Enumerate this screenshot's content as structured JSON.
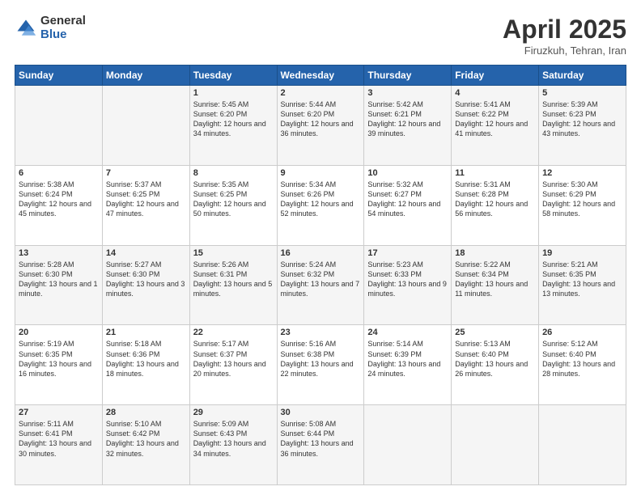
{
  "logo": {
    "general": "General",
    "blue": "Blue"
  },
  "title": "April 2025",
  "location": "Firuzkuh, Tehran, Iran",
  "weekdays": [
    "Sunday",
    "Monday",
    "Tuesday",
    "Wednesday",
    "Thursday",
    "Friday",
    "Saturday"
  ],
  "weeks": [
    [
      {
        "day": "",
        "info": ""
      },
      {
        "day": "",
        "info": ""
      },
      {
        "day": "1",
        "info": "Sunrise: 5:45 AM\nSunset: 6:20 PM\nDaylight: 12 hours and 34 minutes."
      },
      {
        "day": "2",
        "info": "Sunrise: 5:44 AM\nSunset: 6:20 PM\nDaylight: 12 hours and 36 minutes."
      },
      {
        "day": "3",
        "info": "Sunrise: 5:42 AM\nSunset: 6:21 PM\nDaylight: 12 hours and 39 minutes."
      },
      {
        "day": "4",
        "info": "Sunrise: 5:41 AM\nSunset: 6:22 PM\nDaylight: 12 hours and 41 minutes."
      },
      {
        "day": "5",
        "info": "Sunrise: 5:39 AM\nSunset: 6:23 PM\nDaylight: 12 hours and 43 minutes."
      }
    ],
    [
      {
        "day": "6",
        "info": "Sunrise: 5:38 AM\nSunset: 6:24 PM\nDaylight: 12 hours and 45 minutes."
      },
      {
        "day": "7",
        "info": "Sunrise: 5:37 AM\nSunset: 6:25 PM\nDaylight: 12 hours and 47 minutes."
      },
      {
        "day": "8",
        "info": "Sunrise: 5:35 AM\nSunset: 6:25 PM\nDaylight: 12 hours and 50 minutes."
      },
      {
        "day": "9",
        "info": "Sunrise: 5:34 AM\nSunset: 6:26 PM\nDaylight: 12 hours and 52 minutes."
      },
      {
        "day": "10",
        "info": "Sunrise: 5:32 AM\nSunset: 6:27 PM\nDaylight: 12 hours and 54 minutes."
      },
      {
        "day": "11",
        "info": "Sunrise: 5:31 AM\nSunset: 6:28 PM\nDaylight: 12 hours and 56 minutes."
      },
      {
        "day": "12",
        "info": "Sunrise: 5:30 AM\nSunset: 6:29 PM\nDaylight: 12 hours and 58 minutes."
      }
    ],
    [
      {
        "day": "13",
        "info": "Sunrise: 5:28 AM\nSunset: 6:30 PM\nDaylight: 13 hours and 1 minute."
      },
      {
        "day": "14",
        "info": "Sunrise: 5:27 AM\nSunset: 6:30 PM\nDaylight: 13 hours and 3 minutes."
      },
      {
        "day": "15",
        "info": "Sunrise: 5:26 AM\nSunset: 6:31 PM\nDaylight: 13 hours and 5 minutes."
      },
      {
        "day": "16",
        "info": "Sunrise: 5:24 AM\nSunset: 6:32 PM\nDaylight: 13 hours and 7 minutes."
      },
      {
        "day": "17",
        "info": "Sunrise: 5:23 AM\nSunset: 6:33 PM\nDaylight: 13 hours and 9 minutes."
      },
      {
        "day": "18",
        "info": "Sunrise: 5:22 AM\nSunset: 6:34 PM\nDaylight: 13 hours and 11 minutes."
      },
      {
        "day": "19",
        "info": "Sunrise: 5:21 AM\nSunset: 6:35 PM\nDaylight: 13 hours and 13 minutes."
      }
    ],
    [
      {
        "day": "20",
        "info": "Sunrise: 5:19 AM\nSunset: 6:35 PM\nDaylight: 13 hours and 16 minutes."
      },
      {
        "day": "21",
        "info": "Sunrise: 5:18 AM\nSunset: 6:36 PM\nDaylight: 13 hours and 18 minutes."
      },
      {
        "day": "22",
        "info": "Sunrise: 5:17 AM\nSunset: 6:37 PM\nDaylight: 13 hours and 20 minutes."
      },
      {
        "day": "23",
        "info": "Sunrise: 5:16 AM\nSunset: 6:38 PM\nDaylight: 13 hours and 22 minutes."
      },
      {
        "day": "24",
        "info": "Sunrise: 5:14 AM\nSunset: 6:39 PM\nDaylight: 13 hours and 24 minutes."
      },
      {
        "day": "25",
        "info": "Sunrise: 5:13 AM\nSunset: 6:40 PM\nDaylight: 13 hours and 26 minutes."
      },
      {
        "day": "26",
        "info": "Sunrise: 5:12 AM\nSunset: 6:40 PM\nDaylight: 13 hours and 28 minutes."
      }
    ],
    [
      {
        "day": "27",
        "info": "Sunrise: 5:11 AM\nSunset: 6:41 PM\nDaylight: 13 hours and 30 minutes."
      },
      {
        "day": "28",
        "info": "Sunrise: 5:10 AM\nSunset: 6:42 PM\nDaylight: 13 hours and 32 minutes."
      },
      {
        "day": "29",
        "info": "Sunrise: 5:09 AM\nSunset: 6:43 PM\nDaylight: 13 hours and 34 minutes."
      },
      {
        "day": "30",
        "info": "Sunrise: 5:08 AM\nSunset: 6:44 PM\nDaylight: 13 hours and 36 minutes."
      },
      {
        "day": "",
        "info": ""
      },
      {
        "day": "",
        "info": ""
      },
      {
        "day": "",
        "info": ""
      }
    ]
  ]
}
